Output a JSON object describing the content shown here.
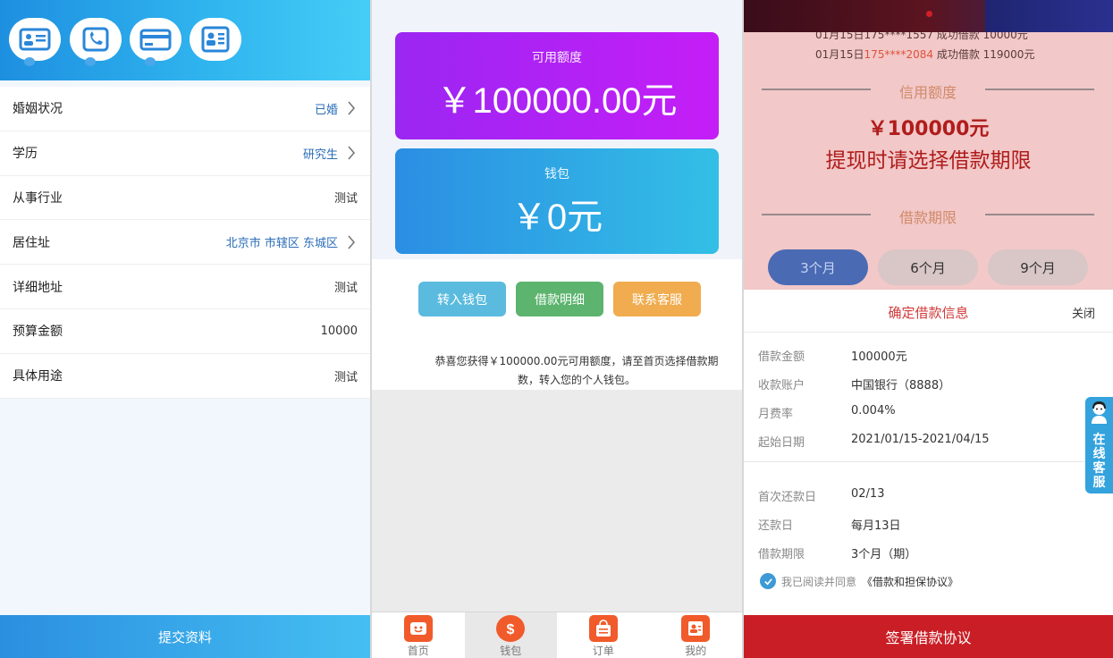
{
  "panel1": {
    "header_icons": [
      "id-card-icon",
      "phone-contact-icon",
      "bank-card-icon",
      "profile-card-icon"
    ],
    "rows": [
      {
        "label": "婚姻状况",
        "value": "已婚"
      },
      {
        "label": "学历",
        "value": "研究生"
      },
      {
        "label": "从事行业",
        "value": "测试"
      },
      {
        "label": "居住址",
        "value": "北京市 市辖区 东城区"
      },
      {
        "label": "详细地址",
        "value": "测试"
      },
      {
        "label": "预算金额",
        "value": "10000"
      },
      {
        "label": "具体用途",
        "value": "测试"
      }
    ],
    "submit_label": "提交资料"
  },
  "panel2": {
    "credit_label": "可用额度",
    "credit_amount": "￥100000.00元",
    "wallet_label": "钱包",
    "wallet_amount": "￥0元",
    "buttons": [
      "转入钱包",
      "借款明细",
      "联系客服"
    ],
    "congrats_text": "恭喜您获得￥100000.00元可用额度，请至首页选择借款期数，转入您的个人钱包。",
    "tabs": [
      {
        "label": "首页",
        "icon": "home-face-icon"
      },
      {
        "label": "钱包",
        "icon": "money-bag-icon"
      },
      {
        "label": "订单",
        "icon": "order-bag-icon"
      },
      {
        "label": "我的",
        "icon": "profile-icon"
      }
    ],
    "active_tab": "钱包",
    "colors": {
      "credit_card": "#b020f5",
      "wallet_card": "#2fa6e4",
      "btn1": "#5bbbde",
      "btn2": "#5cb46e",
      "btn3": "#f0ac4f",
      "tab_icon": "#f15a2a"
    }
  },
  "panel3": {
    "scroll_partial": "01月15日175****1557 成功借款 10000元",
    "scroll_date": "01月15日",
    "scroll_phone": "175****2084",
    "scroll_rest": " 成功借款 119000元",
    "credit_title": "信用额度",
    "credit_amount": "￥100000元",
    "tip": "提现时请选择借款期限",
    "term_title": "借款期限",
    "terms": [
      "3个月",
      "6个月",
      "9个月"
    ],
    "selected_term": "3个月",
    "sheet_title": "确定借款信息",
    "close_label": "关闭",
    "info_top": [
      {
        "key": "借款金额",
        "value": "100000元"
      },
      {
        "key": "收款账户",
        "value": "中国银行（8888）"
      },
      {
        "key": "月费率",
        "value": "0.004%"
      },
      {
        "key": "起始日期",
        "value": "2021/01/15-2021/04/15"
      }
    ],
    "info_bottom": [
      {
        "key": "首次还款日",
        "value": "02/13"
      },
      {
        "key": "还款日",
        "value": "每月13日"
      },
      {
        "key": "借款期限",
        "value": "3个月（期）"
      }
    ],
    "agree_text": "我已阅读并同意",
    "agreement_link": "《借款和担保协议》",
    "sign_button": "签署借款协议",
    "float_cs": "在线客服",
    "colors": {
      "sign_button": "#c91e26",
      "selected_term": "#4a6ab4",
      "float_cs": "#33a2dd"
    }
  }
}
